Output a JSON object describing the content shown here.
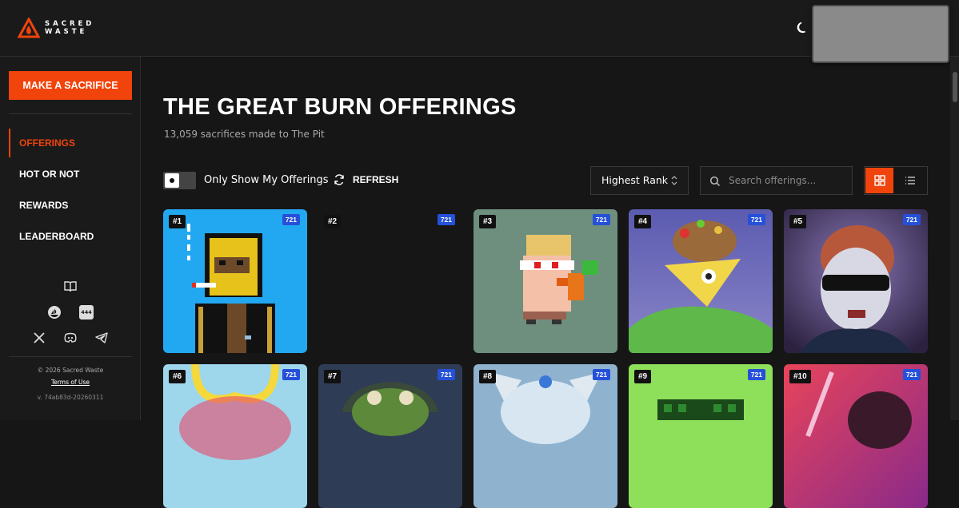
{
  "brand": {
    "line1": "SACRED",
    "line2": "WASTE"
  },
  "header": {
    "theme_icon": "moon-icon"
  },
  "sidebar": {
    "cta_label": "MAKE A SACRIFICE",
    "nav": [
      {
        "label": "OFFERINGS",
        "active": true
      },
      {
        "label": "HOT OR NOT",
        "active": false
      },
      {
        "label": "REWARDS",
        "active": false
      },
      {
        "label": "LEADERBOARD",
        "active": false
      }
    ],
    "social_icons": [
      "book-icon",
      "opensea-icon",
      "444-icon",
      "x-icon",
      "discord-icon",
      "telegram-icon"
    ],
    "social_444_label": "444",
    "footer": {
      "copyright": "© 2026 Sacred Waste",
      "terms": "Terms of Use",
      "version": "v. 74ab83d-20260311"
    }
  },
  "main": {
    "title": "THE GREAT BURN OFFERINGS",
    "subtitle": "13,059 sacrifices made to The Pit",
    "toggle_label": "Only Show My Offerings",
    "refresh_label": "REFRESH",
    "sort_selected": "Highest Rank",
    "search_placeholder": "Search offerings...",
    "view_mode": "grid"
  },
  "cards": [
    {
      "rank": "#1",
      "standard": "721",
      "bg": "#22a8f0"
    },
    {
      "rank": "#2",
      "standard": "721",
      "bg": "#161616"
    },
    {
      "rank": "#3",
      "standard": "721",
      "bg": "#6e8f7e"
    },
    {
      "rank": "#4",
      "standard": "721",
      "bg": "#6a63b8"
    },
    {
      "rank": "#5",
      "standard": "721",
      "bg": "#4a3e6a"
    },
    {
      "rank": "#6",
      "standard": "721",
      "bg": "#9ed7ec"
    },
    {
      "rank": "#7",
      "standard": "721",
      "bg": "#2f3c55"
    },
    {
      "rank": "#8",
      "standard": "721",
      "bg": "#8fb3cf"
    },
    {
      "rank": "#9",
      "standard": "721",
      "bg": "#8ee05a"
    },
    {
      "rank": "#10",
      "standard": "721",
      "bg": "#c83a6a"
    }
  ],
  "colors": {
    "accent": "#f0440c",
    "badge_blue": "#2550d8",
    "background": "#161616"
  }
}
